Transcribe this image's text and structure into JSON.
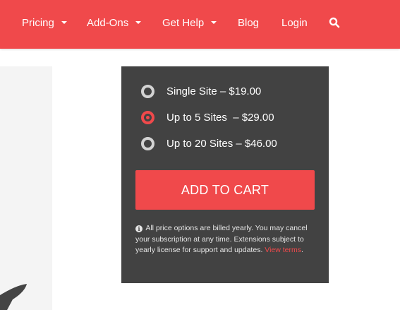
{
  "nav": {
    "items": [
      {
        "label": "Pricing",
        "has_caret": true
      },
      {
        "label": "Add-Ons",
        "has_caret": true
      },
      {
        "label": "Get Help",
        "has_caret": true
      },
      {
        "label": "Blog",
        "has_caret": false
      },
      {
        "label": "Login",
        "has_caret": false
      }
    ],
    "search_icon": "search-icon",
    "caret_icon": "caret-down-icon"
  },
  "pricing": {
    "options": [
      {
        "label": "Single Site – $19.00",
        "selected": false
      },
      {
        "label": "Up to 5 Sites  – $29.00",
        "selected": true
      },
      {
        "label": "Up to 20 Sites – $46.00",
        "selected": false
      }
    ],
    "add_to_cart_label": "ADD TO CART",
    "note_icon": "info-icon",
    "note_text": "All price options are billed yearly. You may cancel your subscription at any time. Extensions subject to yearly license for support and updates.",
    "note_link": "View terms",
    "note_end": "."
  },
  "colors": {
    "brand_red": "#f0494b",
    "card_bg": "#424242",
    "radio_unselected": "#d3d3d3"
  }
}
